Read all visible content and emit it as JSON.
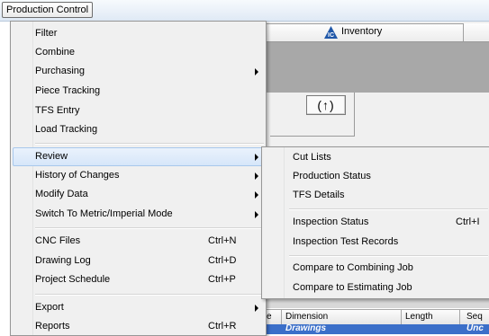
{
  "menubar": {
    "production_control": "Production Control"
  },
  "background": {
    "tab_inventory": "Inventory",
    "updown_button": "(↑)",
    "table": {
      "columns": [
        "e",
        "Dimension",
        "Length",
        "Seq"
      ],
      "row": [
        "Drawings",
        "Unc"
      ]
    }
  },
  "main_menu": {
    "items": [
      {
        "label": "Filter"
      },
      {
        "label": "Combine"
      },
      {
        "label": "Purchasing"
      },
      {
        "label": "Piece Tracking"
      },
      {
        "label": "TFS Entry"
      },
      {
        "label": "Load Tracking"
      },
      {
        "label": "Review"
      },
      {
        "label": "History of Changes"
      },
      {
        "label": "Modify Data"
      },
      {
        "label": "Switch To Metric/Imperial Mode"
      },
      {
        "label": "CNC Files",
        "shortcut": "Ctrl+N"
      },
      {
        "label": "Drawing Log",
        "shortcut": "Ctrl+D"
      },
      {
        "label": "Project Schedule",
        "shortcut": "Ctrl+P"
      },
      {
        "label": "Export"
      },
      {
        "label": "Reports",
        "shortcut": "Ctrl+R"
      }
    ]
  },
  "review_submenu": {
    "items": [
      {
        "label": "Cut Lists"
      },
      {
        "label": "Production Status"
      },
      {
        "label": "TFS Details"
      },
      {
        "label": "Inspection Status",
        "shortcut": "Ctrl+I"
      },
      {
        "label": "Inspection Test Records"
      },
      {
        "label": "Compare to Combining Job"
      },
      {
        "label": "Compare to Estimating Job"
      }
    ]
  },
  "colors": {
    "highlight_bg": "#d6e6f9",
    "highlight_border": "#a8c8ec",
    "selected_row": "#3b6fc9",
    "menu_bg": "#f0f0f0"
  }
}
